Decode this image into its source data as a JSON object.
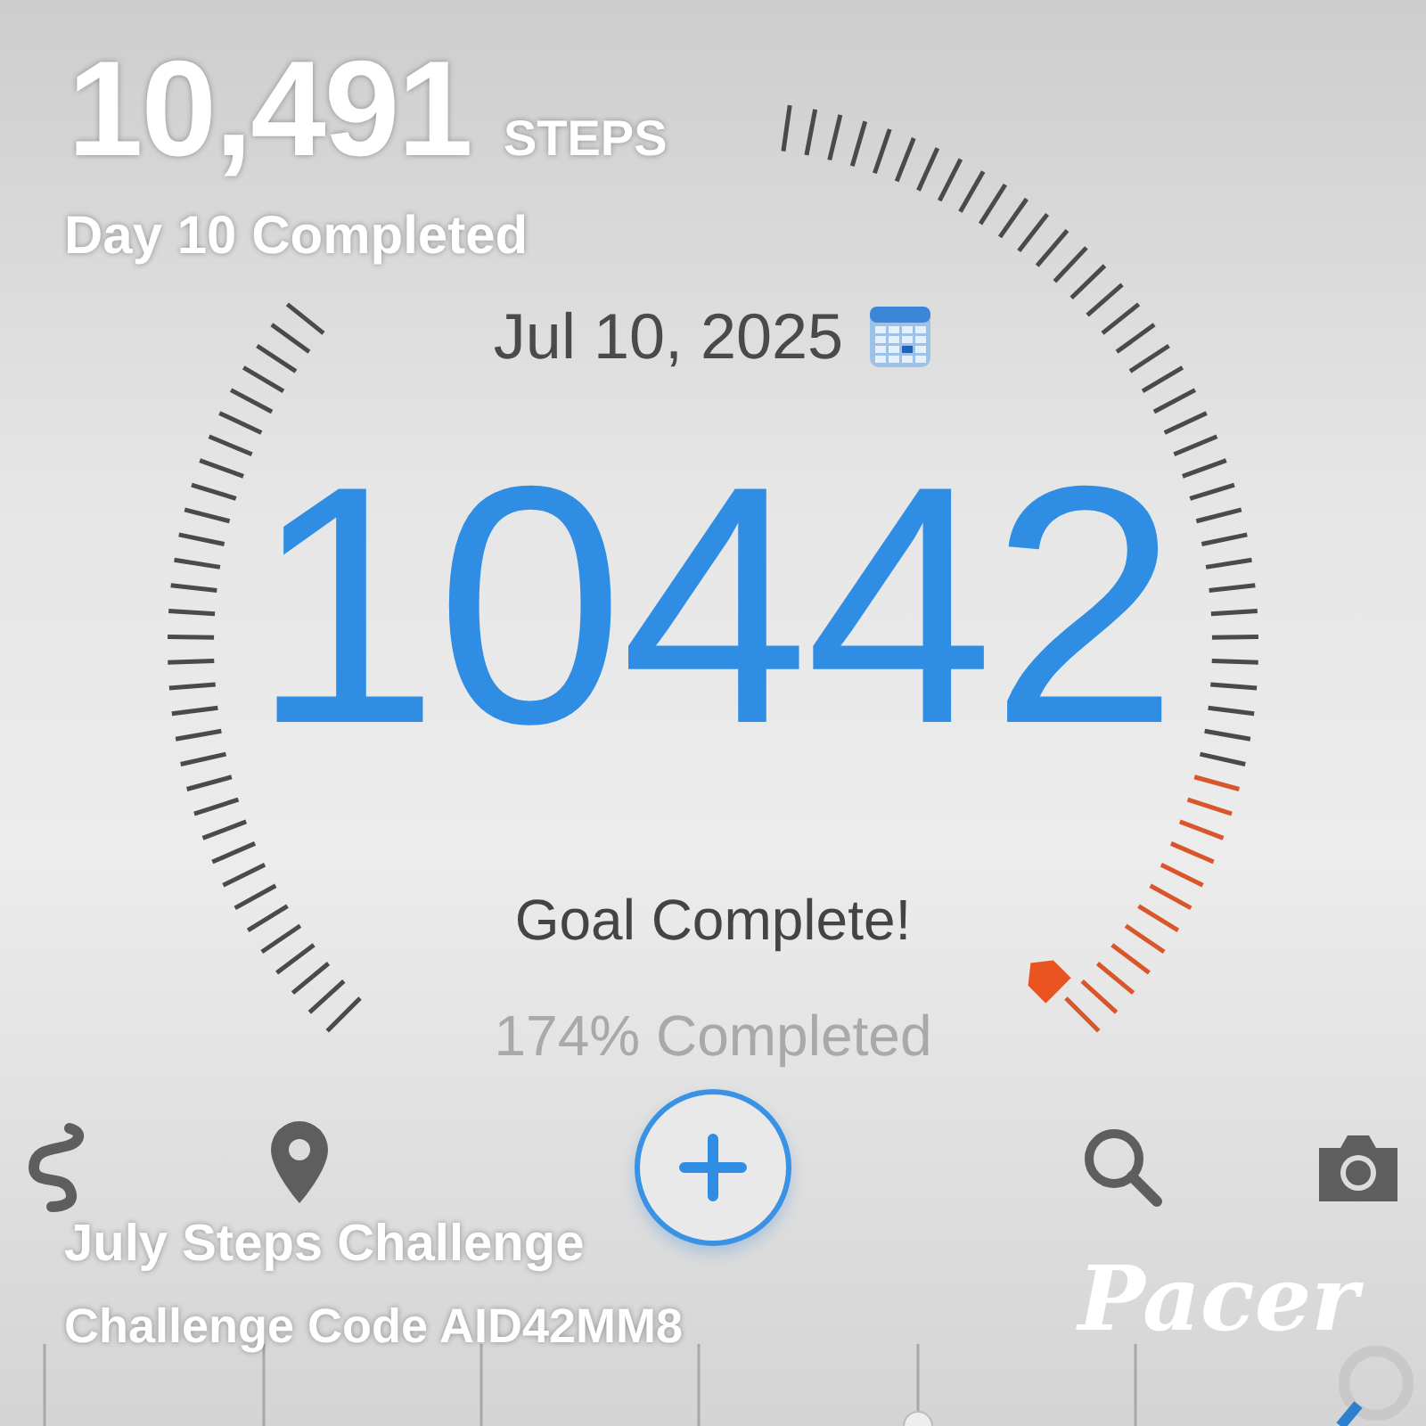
{
  "overlay": {
    "steps": "10,491",
    "steps_unit": "STEPS",
    "day": "Day 10 Completed",
    "challenge": "July Steps Challenge",
    "code": "Challenge Code AID42MM8",
    "brand": "Pacer"
  },
  "date": "Jul 10, 2025",
  "count": "10442",
  "goal_message": "Goal Complete!",
  "percent": "174% Completed",
  "nav": [
    {
      "kind": "route"
    },
    {
      "kind": "pin"
    },
    {
      "kind": "add"
    },
    {
      "kind": "search"
    },
    {
      "kind": "camera"
    }
  ]
}
